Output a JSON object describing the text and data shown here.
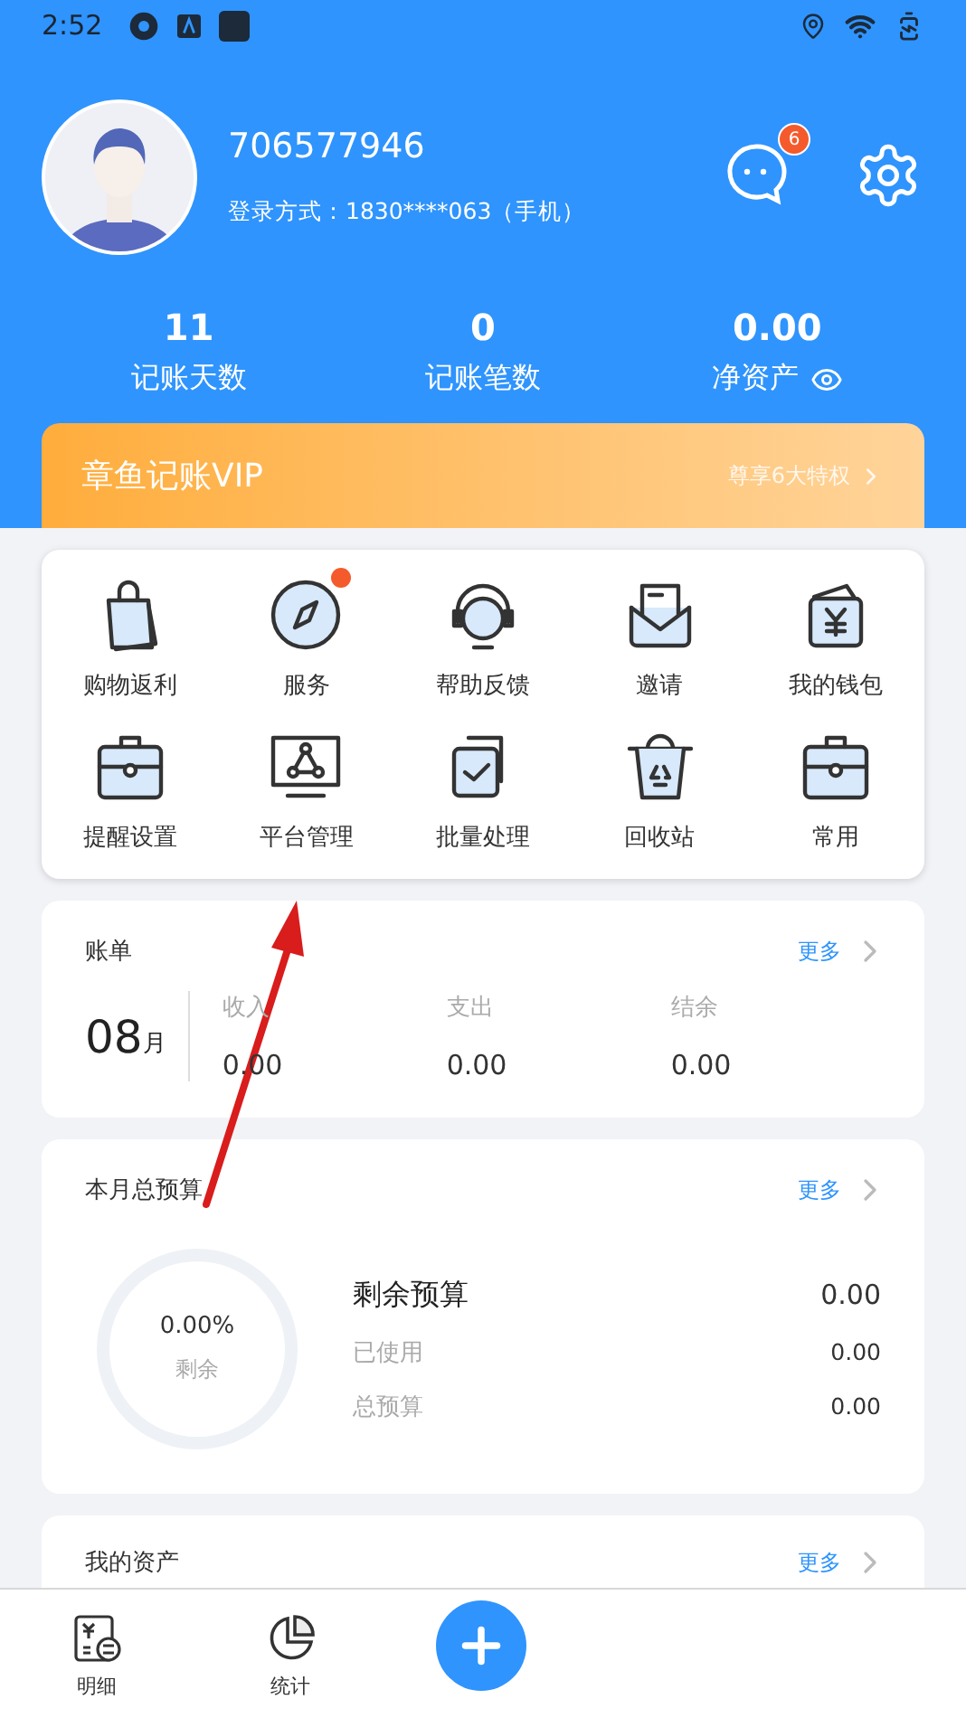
{
  "status_bar": {
    "time": "2:52"
  },
  "profile": {
    "user_id": "706577946",
    "login_method": "登录方式：1830****063（手机）",
    "message_badge": "6"
  },
  "stats": [
    {
      "value": "11",
      "label": "记账天数",
      "kind": "plain"
    },
    {
      "value": "0",
      "label": "记账笔数",
      "kind": "plain"
    },
    {
      "value": "0.00",
      "label": "净资产",
      "kind": "eye"
    }
  ],
  "vip_banner": {
    "title": "章鱼记账VIP",
    "link": "尊享6大特权"
  },
  "shortcuts": [
    {
      "label": "购物返利",
      "kind": "bag",
      "dot": false
    },
    {
      "label": "服务",
      "kind": "compass",
      "dot": true
    },
    {
      "label": "帮助反馈",
      "kind": "headset",
      "dot": false
    },
    {
      "label": "邀请",
      "kind": "envelope",
      "dot": false
    },
    {
      "label": "我的钱包",
      "kind": "wallet",
      "dot": false
    },
    {
      "label": "提醒设置",
      "kind": "case",
      "dot": false
    },
    {
      "label": "平台管理",
      "kind": "monitor",
      "dot": false
    },
    {
      "label": "批量处理",
      "kind": "check",
      "dot": false
    },
    {
      "label": "回收站",
      "kind": "bin",
      "dot": false
    },
    {
      "label": "常用",
      "kind": "case",
      "dot": false
    }
  ],
  "bill_card": {
    "title": "账单",
    "more": "更多",
    "month": "08",
    "month_unit": "月",
    "columns": [
      {
        "label": "收入",
        "value": "0.00"
      },
      {
        "label": "支出",
        "value": "0.00"
      },
      {
        "label": "结余",
        "value": "0.00"
      }
    ]
  },
  "budget_card": {
    "title": "本月总预算",
    "more": "更多",
    "ring_percent": "0.00%",
    "ring_label": "剩余",
    "level": 0,
    "rows": [
      {
        "label": "剩余预算",
        "value": "0.00",
        "kind": "main"
      },
      {
        "label": "已使用",
        "value": "0.00",
        "kind": "sub"
      },
      {
        "label": "总预算",
        "value": "0.00",
        "kind": "sub"
      }
    ]
  },
  "assets_card": {
    "title": "我的资产",
    "more": "更多"
  },
  "bottom_nav": [
    {
      "label": "明细",
      "kind": "detail"
    },
    {
      "label": "统计",
      "kind": "stats"
    },
    {
      "kind": "add"
    }
  ]
}
